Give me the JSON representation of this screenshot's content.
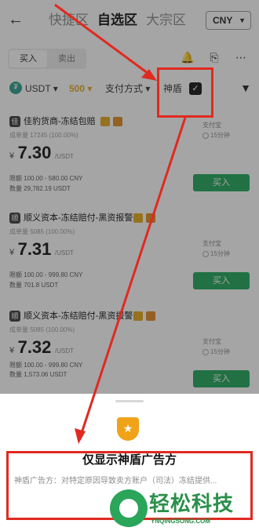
{
  "header": {
    "back_icon": "arrow-left-icon",
    "tabs": [
      {
        "label": "快捷区"
      },
      {
        "label": "自选区"
      },
      {
        "label": "大宗区"
      }
    ],
    "currency": "CNY"
  },
  "trade_toggle": {
    "buy": "买入",
    "sell": "卖出"
  },
  "filters": {
    "coin": "USDT",
    "amount": "500",
    "payment": "支付方式",
    "shield_label": "神盾"
  },
  "listings": [
    {
      "merchant": "佳豹货商-冻结包赔",
      "stats": "成单量 17245 (100.00%)",
      "currency_symbol": "¥",
      "price": "7.30",
      "unit": "/USDT",
      "limit": "限额 100.00 - 580.00 CNY",
      "quantity": "数量 29,782.19 USDT",
      "payment": "支付宝",
      "time": "15分钟",
      "button": "买入"
    },
    {
      "merchant": "顺义资本-冻结赔付-黑资报警",
      "stats": "成单量 5085 (100.00%)",
      "currency_symbol": "¥",
      "price": "7.31",
      "unit": "/USDT",
      "limit": "限额 100.00 - 999.80 CNY",
      "quantity": "数量 701.8 USDT",
      "payment": "支付宝",
      "time": "15分钟",
      "button": "买入"
    },
    {
      "merchant": "顺义资本-冻结赔付-黑资报警",
      "stats": "成单量 5085 (100.00%)",
      "currency_symbol": "¥",
      "price": "7.32",
      "unit": "/USDT",
      "limit": "限额 100.00 - 999.80 CNY",
      "quantity": "数量 1,573.06 USDT",
      "payment": "支付宝",
      "time": "15分钟",
      "button": "买入"
    }
  ],
  "sheet": {
    "title": "仅显示神盾广告方",
    "description": "神盾广告方：对特定原因导致卖方账户（司法）冻结提供..."
  },
  "watermark": {
    "name": "轻松科技",
    "url": "YNQINGSONG.COM"
  },
  "colors": {
    "accent_green": "#1ea55a",
    "annotation_red": "#e02a20",
    "badge_gold": "#e6a817"
  }
}
